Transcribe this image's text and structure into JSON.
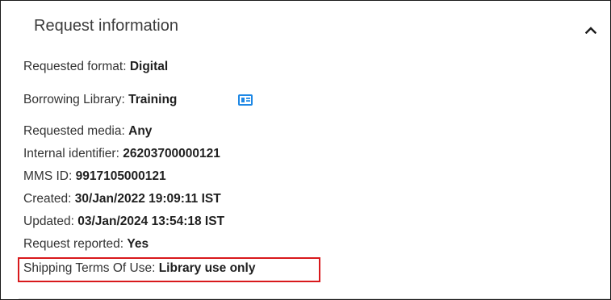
{
  "section": {
    "title": "Request information"
  },
  "fields": {
    "requested_format": {
      "label": "Requested format:",
      "value": "Digital"
    },
    "borrowing_library": {
      "label": "Borrowing Library:",
      "value": "Training"
    },
    "requested_media": {
      "label": "Requested media:",
      "value": "Any"
    },
    "internal_identifier": {
      "label": "Internal identifier:",
      "value": "26203700000121"
    },
    "mms_id": {
      "label": "MMS ID:",
      "value": "9917105000121"
    },
    "created": {
      "label": "Created:",
      "value": "30/Jan/2022 19:09:11 IST"
    },
    "updated": {
      "label": "Updated:",
      "value": "03/Jan/2024 13:54:18 IST"
    },
    "request_reported": {
      "label": "Request reported:",
      "value": "Yes"
    },
    "shipping_terms": {
      "label": "Shipping Terms Of Use:",
      "value": "Library use only"
    }
  },
  "icons": {
    "collapse": "chevron-up-icon",
    "library_card": "contact-card-icon"
  },
  "colors": {
    "accent": "#1e88e5",
    "highlight": "#d8191c"
  }
}
